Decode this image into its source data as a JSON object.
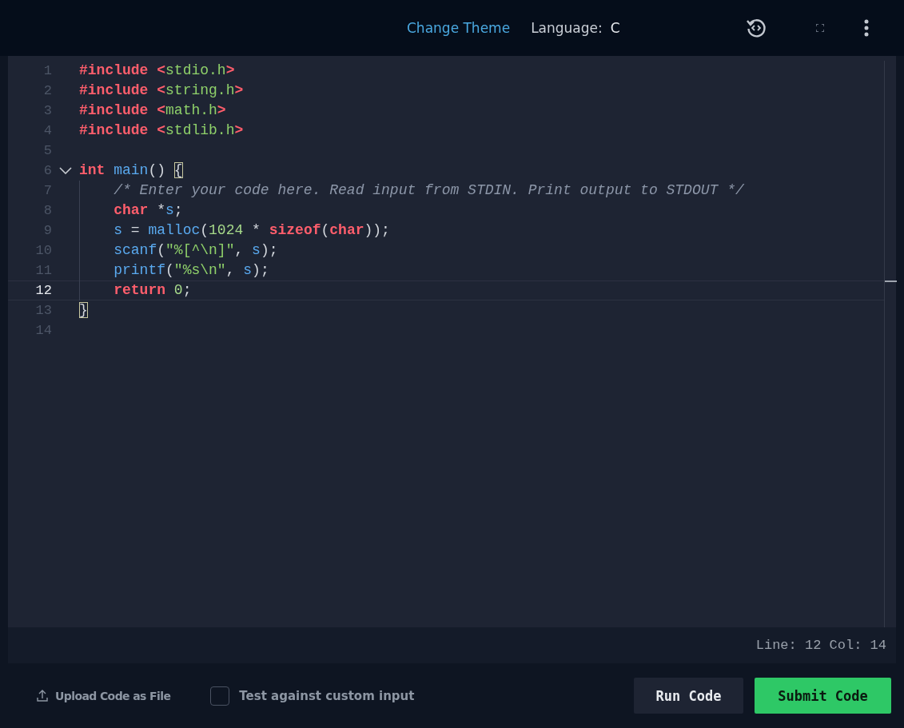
{
  "toolbar": {
    "change_theme": "Change Theme",
    "language_label": "Language:",
    "language": "C"
  },
  "editor": {
    "lines": [
      {
        "number": "1",
        "fold": false,
        "current": false,
        "tokens": [
          {
            "kind": "keyword",
            "text": "#include"
          },
          {
            "kind": "keyword",
            "text": " <"
          },
          {
            "kind": "string",
            "text": "stdio.h"
          },
          {
            "kind": "keyword",
            "text": ">"
          }
        ]
      },
      {
        "number": "2",
        "fold": false,
        "current": false,
        "tokens": [
          {
            "kind": "keyword",
            "text": "#include"
          },
          {
            "kind": "keyword",
            "text": " <"
          },
          {
            "kind": "string",
            "text": "string.h"
          },
          {
            "kind": "keyword",
            "text": ">"
          }
        ]
      },
      {
        "number": "3",
        "fold": false,
        "current": false,
        "tokens": [
          {
            "kind": "keyword",
            "text": "#include"
          },
          {
            "kind": "keyword",
            "text": " <"
          },
          {
            "kind": "string",
            "text": "math.h"
          },
          {
            "kind": "keyword",
            "text": ">"
          }
        ]
      },
      {
        "number": "4",
        "fold": false,
        "current": false,
        "tokens": [
          {
            "kind": "keyword",
            "text": "#include"
          },
          {
            "kind": "keyword",
            "text": " <"
          },
          {
            "kind": "string",
            "text": "stdlib.h"
          },
          {
            "kind": "keyword",
            "text": ">"
          }
        ]
      },
      {
        "number": "5",
        "fold": false,
        "current": false
      },
      {
        "number": "6",
        "fold": true,
        "current": false,
        "tokens": [
          {
            "kind": "keyword",
            "text": "int"
          },
          {
            "kind": "function",
            "text": " main"
          },
          {
            "kind": "plain",
            "text": "() "
          },
          {
            "kind": "match",
            "text": "{"
          }
        ]
      },
      {
        "number": "7",
        "fold": false,
        "current": false,
        "tokens": [
          {
            "kind": "comment",
            "text": "    /* Enter your code here. Read input from STDIN. Print output to STDOUT */"
          }
        ]
      },
      {
        "number": "8",
        "fold": false,
        "current": false,
        "tokens": [
          {
            "kind": "keyword",
            "text": "    char"
          },
          {
            "kind": "plain",
            "text": " *"
          },
          {
            "kind": "function",
            "text": "s"
          },
          {
            "kind": "plain",
            "text": ";"
          }
        ]
      },
      {
        "number": "9",
        "fold": false,
        "current": false,
        "tokens": [
          {
            "kind": "function",
            "text": "    s"
          },
          {
            "kind": "plain",
            "text": " = "
          },
          {
            "kind": "function",
            "text": "malloc"
          },
          {
            "kind": "plain",
            "text": "("
          },
          {
            "kind": "number",
            "text": "1024"
          },
          {
            "kind": "plain",
            "text": " * "
          },
          {
            "kind": "keyword",
            "text": "sizeof"
          },
          {
            "kind": "plain",
            "text": "("
          },
          {
            "kind": "keyword",
            "text": "char"
          },
          {
            "kind": "plain",
            "text": "));"
          }
        ]
      },
      {
        "number": "10",
        "fold": false,
        "current": false,
        "tokens": [
          {
            "kind": "function",
            "text": "    scanf"
          },
          {
            "kind": "plain",
            "text": "("
          },
          {
            "kind": "string",
            "text": "\"%[^\\n]\""
          },
          {
            "kind": "plain",
            "text": ", "
          },
          {
            "kind": "function",
            "text": "s"
          },
          {
            "kind": "plain",
            "text": ");"
          }
        ]
      },
      {
        "number": "11",
        "fold": false,
        "current": false,
        "tokens": [
          {
            "kind": "function",
            "text": "    printf"
          },
          {
            "kind": "plain",
            "text": "("
          },
          {
            "kind": "string",
            "text": "\"%s\\n\""
          },
          {
            "kind": "plain",
            "text": ", "
          },
          {
            "kind": "function",
            "text": "s"
          },
          {
            "kind": "plain",
            "text": ");"
          }
        ]
      },
      {
        "number": "12",
        "fold": false,
        "current": true,
        "tokens": [
          {
            "kind": "keyword",
            "text": "    return"
          },
          {
            "kind": "number",
            "text": " 0"
          },
          {
            "kind": "plain",
            "text": ";"
          }
        ]
      },
      {
        "number": "13",
        "fold": false,
        "current": false,
        "tokens": [
          {
            "kind": "match",
            "text": "}"
          }
        ]
      },
      {
        "number": "14",
        "fold": false,
        "current": false
      }
    ],
    "status": "Line: 12 Col: 14"
  },
  "footer": {
    "upload": "Upload Code as File",
    "custom_input": {
      "label": "Test against custom input",
      "checked": false
    },
    "run": "Run Code",
    "submit": "Submit Code"
  }
}
